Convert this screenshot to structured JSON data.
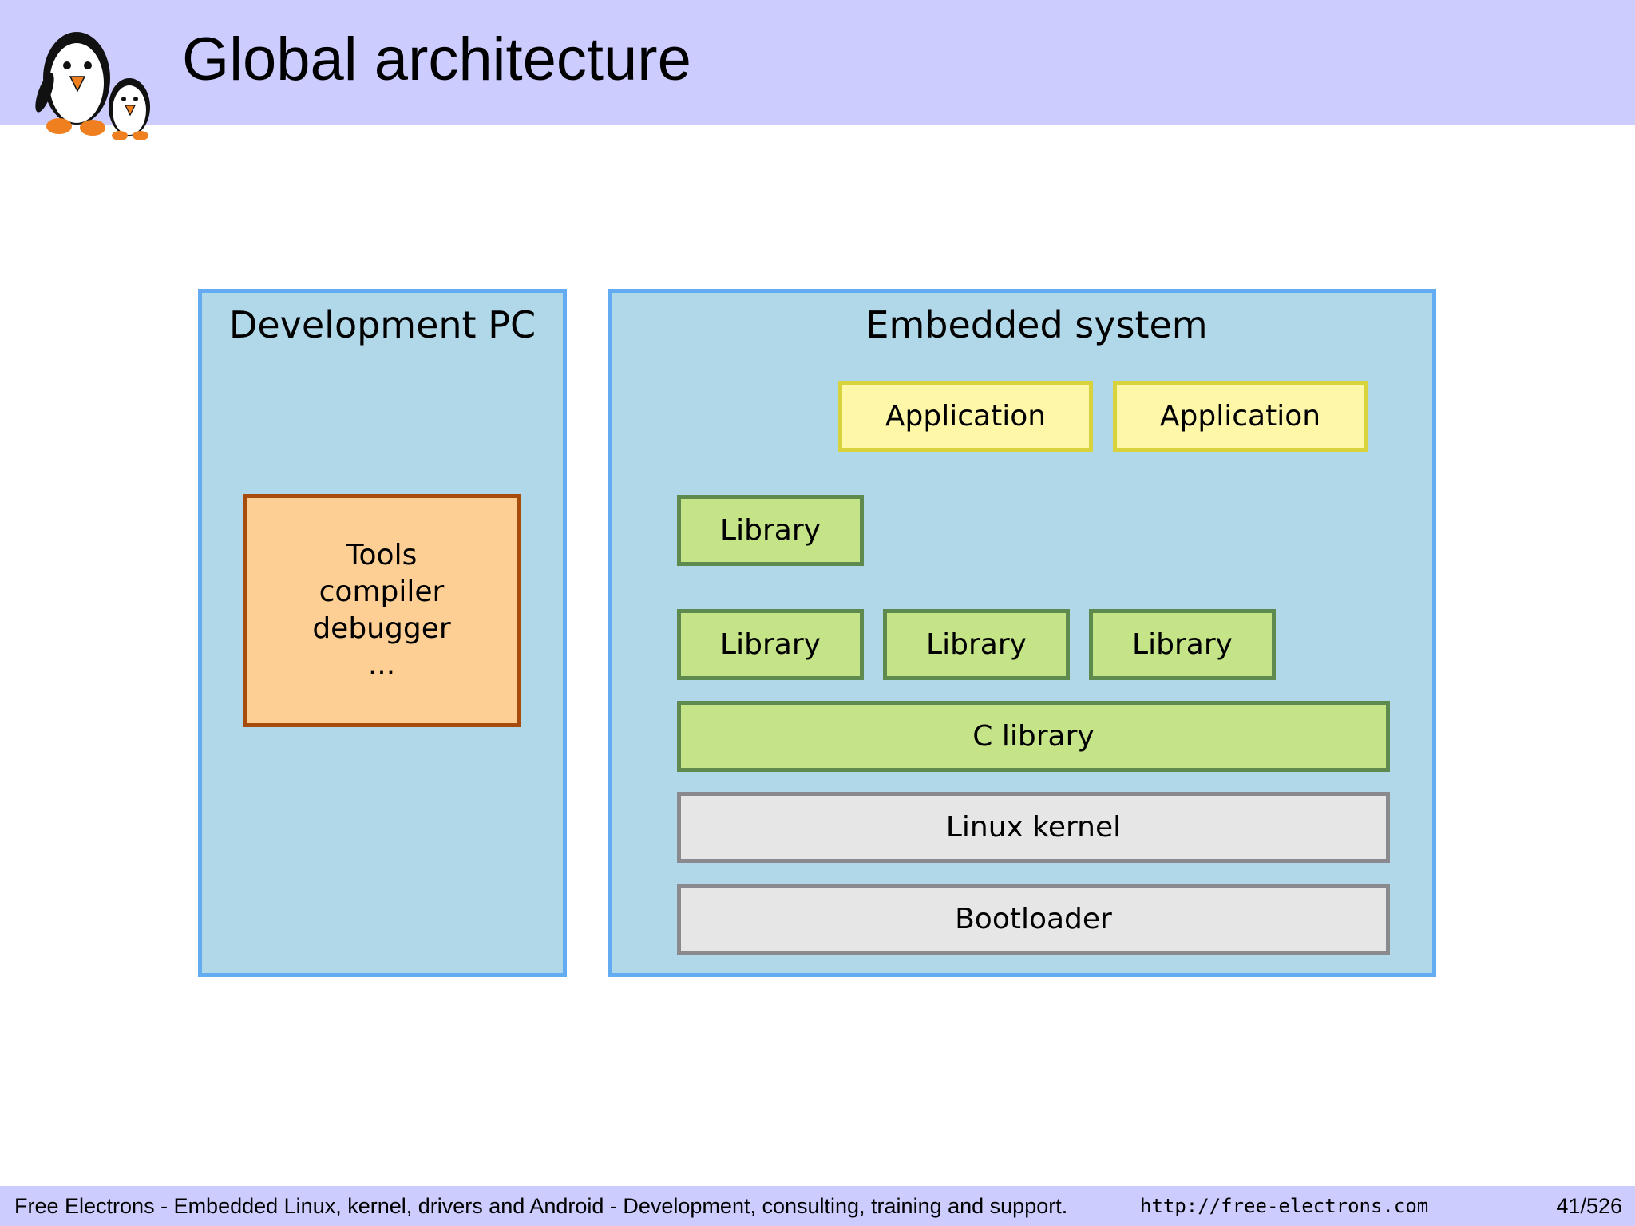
{
  "header": {
    "title": "Global architecture"
  },
  "diagram": {
    "dev_pc": {
      "title": "Development PC",
      "tools_lines": [
        "Tools",
        "compiler",
        "debugger",
        "..."
      ]
    },
    "embedded": {
      "title": "Embedded system",
      "applications": [
        "Application",
        "Application"
      ],
      "library_top": "Library",
      "libraries_row": [
        "Library",
        "Library",
        "Library"
      ],
      "c_library": "C library",
      "kernel": "Linux kernel",
      "bootloader": "Bootloader"
    }
  },
  "footer": {
    "text": "Free Electrons - Embedded Linux, kernel, drivers and Android - Development, consulting, training and support.",
    "url": "http://free-electrons.com",
    "page": "41/526"
  },
  "colors": {
    "header_bg": "#ccccff",
    "panel_bg": "#b0d8e8",
    "panel_border": "#63acf2",
    "application": "#fff7a8",
    "library": "#c5e387",
    "system": "#e6e6e6",
    "tools": "#fecf94"
  }
}
